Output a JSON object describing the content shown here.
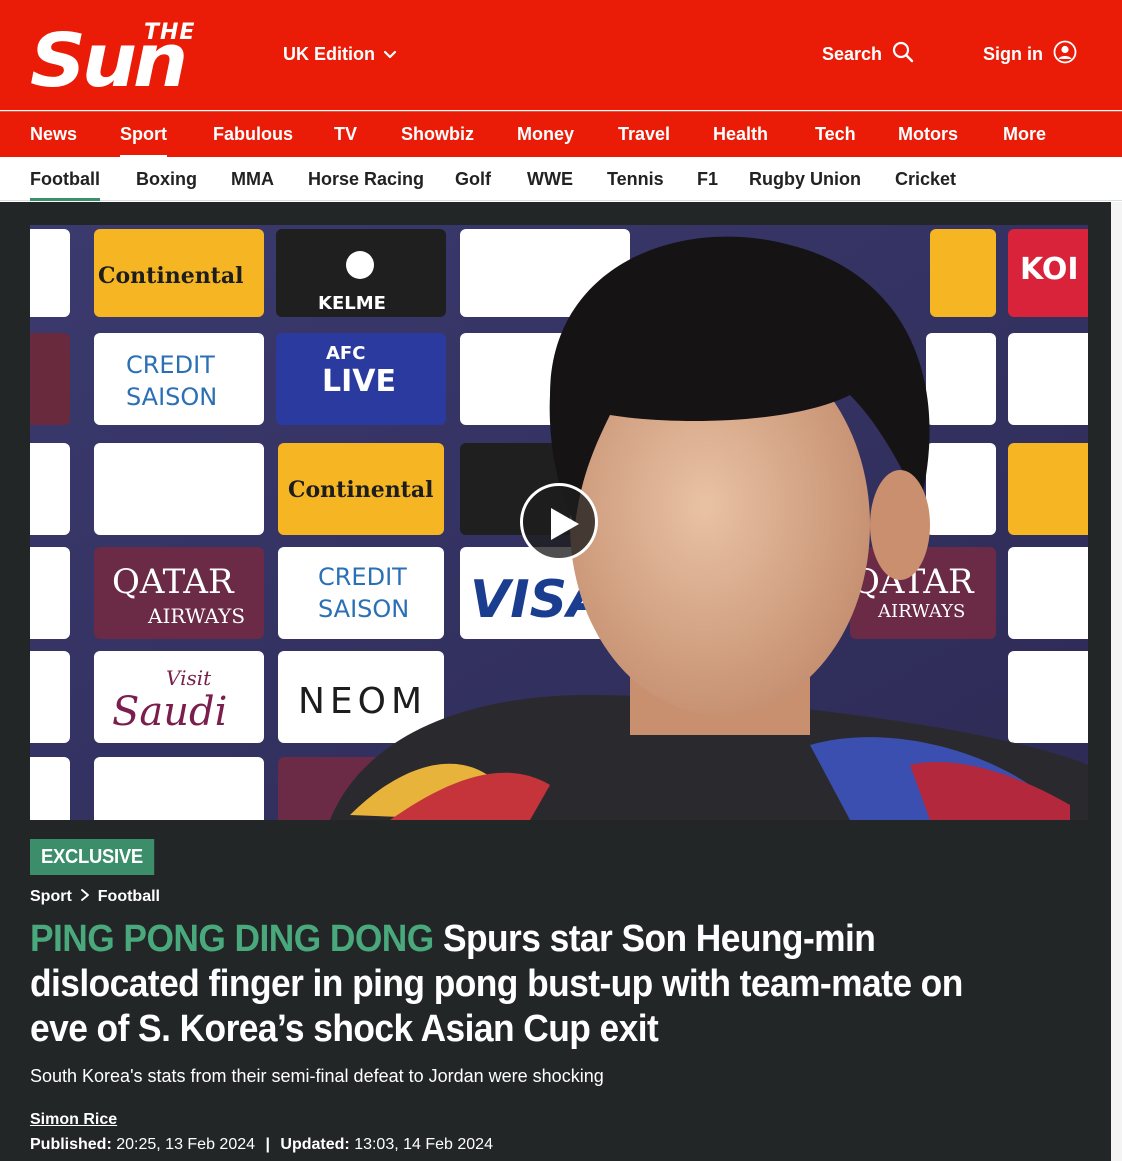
{
  "masthead": {
    "logo_the": "THE",
    "logo_sun": "Sun",
    "edition_label": "UK Edition",
    "search_label": "Search",
    "signin_label": "Sign in"
  },
  "primary_nav": [
    {
      "label": "News",
      "active": false
    },
    {
      "label": "Sport",
      "active": true
    },
    {
      "label": "Fabulous",
      "active": false
    },
    {
      "label": "TV",
      "active": false
    },
    {
      "label": "Showbiz",
      "active": false
    },
    {
      "label": "Money",
      "active": false
    },
    {
      "label": "Travel",
      "active": false
    },
    {
      "label": "Health",
      "active": false
    },
    {
      "label": "Tech",
      "active": false
    },
    {
      "label": "Motors",
      "active": false
    },
    {
      "label": "More",
      "active": false
    }
  ],
  "secondary_nav": [
    {
      "label": "Football",
      "active": true
    },
    {
      "label": "Boxing",
      "active": false
    },
    {
      "label": "MMA",
      "active": false
    },
    {
      "label": "Horse Racing",
      "active": false
    },
    {
      "label": "Golf",
      "active": false
    },
    {
      "label": "WWE",
      "active": false
    },
    {
      "label": "Tennis",
      "active": false
    },
    {
      "label": "F1",
      "active": false
    },
    {
      "label": "Rugby Union",
      "active": false
    },
    {
      "label": "Cricket",
      "active": false
    }
  ],
  "video": {
    "backdrop_labels": {
      "continental": "Continental",
      "kelme": "KELME",
      "credit": "CREDIT",
      "saison": "SAISON",
      "afc": "AFC",
      "live": "LIVE",
      "qatar": "QATAR",
      "airways": "AIRWAYS",
      "neom": "NEOM",
      "visit": "Visit",
      "saudi": "Saudi",
      "visa": "VISA",
      "kor": "KOI"
    }
  },
  "article": {
    "badge": "Exclusive",
    "breadcrumb": {
      "section": "Sport",
      "subsection": "Football"
    },
    "headline_kicker": "PING PONG DING DONG",
    "headline": "Spurs star Son Heung-min dislocated finger in ping pong bust-up with team-mate on eve of S. Korea’s shock Asian Cup exit",
    "standfirst": "South Korea's stats from their semi-final defeat to Jordan were shocking",
    "author": "Simon Rice",
    "published_label": "Published:",
    "published_value": "20:25, 13 Feb 2024",
    "separator": "|",
    "updated_label": "Updated:",
    "updated_value": "13:03, 14 Feb 2024"
  },
  "colors": {
    "brand_red": "#eb1c07",
    "article_bg": "#232627",
    "accent_green": "#3c8d69"
  }
}
